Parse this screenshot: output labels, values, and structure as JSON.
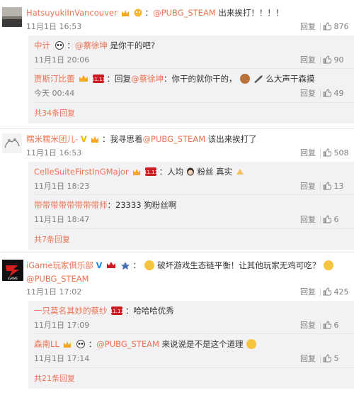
{
  "comments": [
    {
      "user": "HatsuyukiInVancouver",
      "text_prefix": "：",
      "mention": "@PUBG_STEAM",
      "text": " 出来挨打！！！！",
      "time": "11月1日 16:53",
      "reply_label": "回复",
      "likes": "876",
      "replies": [
        {
          "user": "中计",
          "text_prefix": "：",
          "mention": "@蔡徐坤",
          "text": " 是你干的吧?",
          "time": "11月1日 20:06",
          "reply_label": "回复",
          "likes": "90"
        },
        {
          "user": "贾斯汀比蕾",
          "text_prefix": "：回复",
          "mention": "@蔡徐坤",
          "text": "：你干的就你干的，",
          "text2": "么大声干森摸",
          "time": "今天 00:44",
          "reply_label": "回复",
          "likes": "49"
        }
      ],
      "more": "共34条回复"
    },
    {
      "user": "糯米糯米团儿-",
      "text_prefix": "：我寻思着",
      "mention": "@PUBG_STEAM",
      "text": " 该出来挨打了",
      "time": "11月1日 16:53",
      "reply_label": "回复",
      "likes": "508",
      "replies": [
        {
          "user": "CelleSuiteFirstInGMajor",
          "text_prefix": "：人均",
          "mention": "",
          "text": "粉丝 真实",
          "time": "11月1日 18:23",
          "reply_label": "回复",
          "likes": "13"
        },
        {
          "user": "带带带带带带带带师",
          "text_prefix": "：",
          "mention": "",
          "text": "23333 狗粉丝啊",
          "time": "11月1日 18:47",
          "reply_label": "回复",
          "likes": "6"
        }
      ],
      "more": "共7条回复"
    },
    {
      "user": "iGame玩家俱乐部",
      "text_prefix": "：",
      "mention": "",
      "text": "破坏游戏生态链平衡！让其他玩家无鸡可吃？",
      "mention2": "@PUBG_STEAM",
      "time": "11月1日 17:02",
      "reply_label": "回复",
      "likes": "425",
      "replies": [
        {
          "user": "一只莫名其妙的蔡纱",
          "text_prefix": "：",
          "mention": "",
          "text": "哈哈哈优秀",
          "time": "11月1日 17:09",
          "reply_label": "回复",
          "likes": "6"
        },
        {
          "user": "森南LL",
          "text_prefix": "：",
          "mention": "@PUBG_STEAM",
          "text": " 来说说是不是这个道理",
          "time": "11月1日 17:14",
          "reply_label": "回复",
          "likes": "5"
        }
      ],
      "more": "共21条回复"
    }
  ],
  "badge_text": "11.11",
  "v_mark": "V",
  "logo_text": "iGAME",
  "colors": {
    "username": "#eb7350",
    "meta": "#808080",
    "reply_bg": "#f2f2f5",
    "divider": "#e6e6e6"
  }
}
